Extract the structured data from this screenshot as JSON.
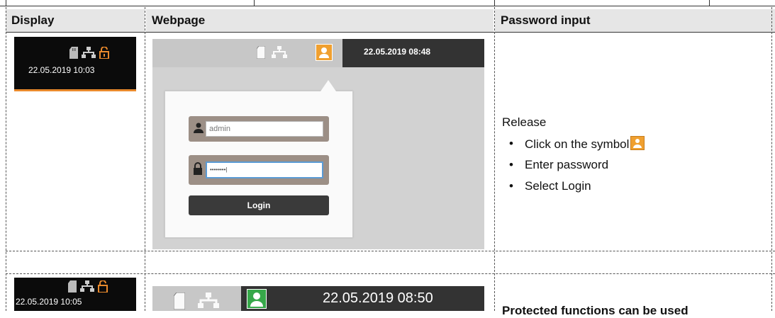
{
  "table": {
    "headers": {
      "display": "Display",
      "webpage": "Webpage",
      "password_input": "Password input"
    }
  },
  "row1": {
    "display": {
      "datetime": "22.05.2019  10:03",
      "icons": [
        "sd-card-icon",
        "network-icon",
        "lock-open-icon"
      ]
    },
    "webpage": {
      "bar_datetime": "22.05.2019   08:48",
      "username_value": "admin",
      "password_value": "••••••••|",
      "login_label": "Login"
    },
    "password_input": {
      "heading": "Release",
      "steps": [
        "Click on the symbol",
        "Enter password",
        "Select Login"
      ]
    }
  },
  "row2": {
    "display": {
      "datetime": "22.05.2019  10:05",
      "icons": [
        "sd-card-icon",
        "network-icon",
        "lock-open-icon"
      ]
    },
    "webpage": {
      "bar_datetime": "22.05.2019   08:50"
    },
    "password_input": {
      "text": "Protected functions can be used"
    }
  },
  "colors": {
    "accent_orange": "#f0a030",
    "accent_green": "#37a84a",
    "dark_bar": "#333333"
  }
}
